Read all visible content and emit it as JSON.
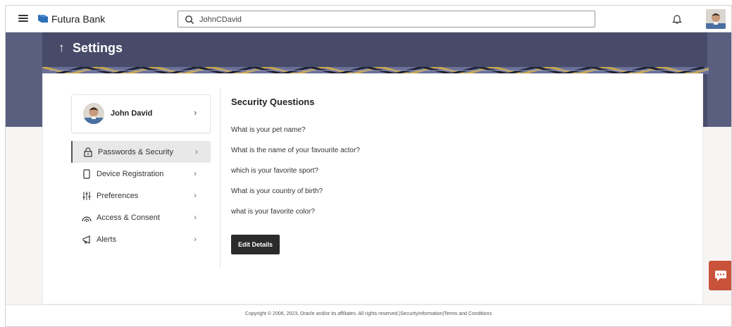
{
  "header": {
    "brand": "Futura Bank",
    "search_value": "JohnCDavid",
    "menu_icon": "hamburger-icon",
    "logo_icon": "futura-flag-icon",
    "notification_icon": "bell-icon"
  },
  "page": {
    "title": "Settings",
    "back_icon": "up-arrow-icon"
  },
  "profile": {
    "name": "John David"
  },
  "menu": {
    "items": [
      {
        "label": "Passwords & Security",
        "icon": "lock-icon",
        "active": true
      },
      {
        "label": "Device Registration",
        "icon": "mobile-icon",
        "active": false
      },
      {
        "label": "Preferences",
        "icon": "sliders-icon",
        "active": false
      },
      {
        "label": "Access & Consent",
        "icon": "access-icon",
        "active": false
      },
      {
        "label": "Alerts",
        "icon": "megaphone-icon",
        "active": false
      }
    ]
  },
  "security": {
    "title": "Security Questions",
    "questions": [
      "What is your pet name?",
      "What is the name of your favourite actor?",
      "which is your favorite sport?",
      "What is your country of birth?",
      "what is your favorite color?"
    ],
    "edit_label": "Edit Details"
  },
  "footer": {
    "text": "Copyright © 2006, 2023, Oracle and/or its affiliates. All rights reserved.|SecurityInformation|Terms and Conditions"
  },
  "colors": {
    "banner": "#4a4e6c",
    "accent_chat": "#c8533a",
    "button": "#2b2b2b"
  }
}
